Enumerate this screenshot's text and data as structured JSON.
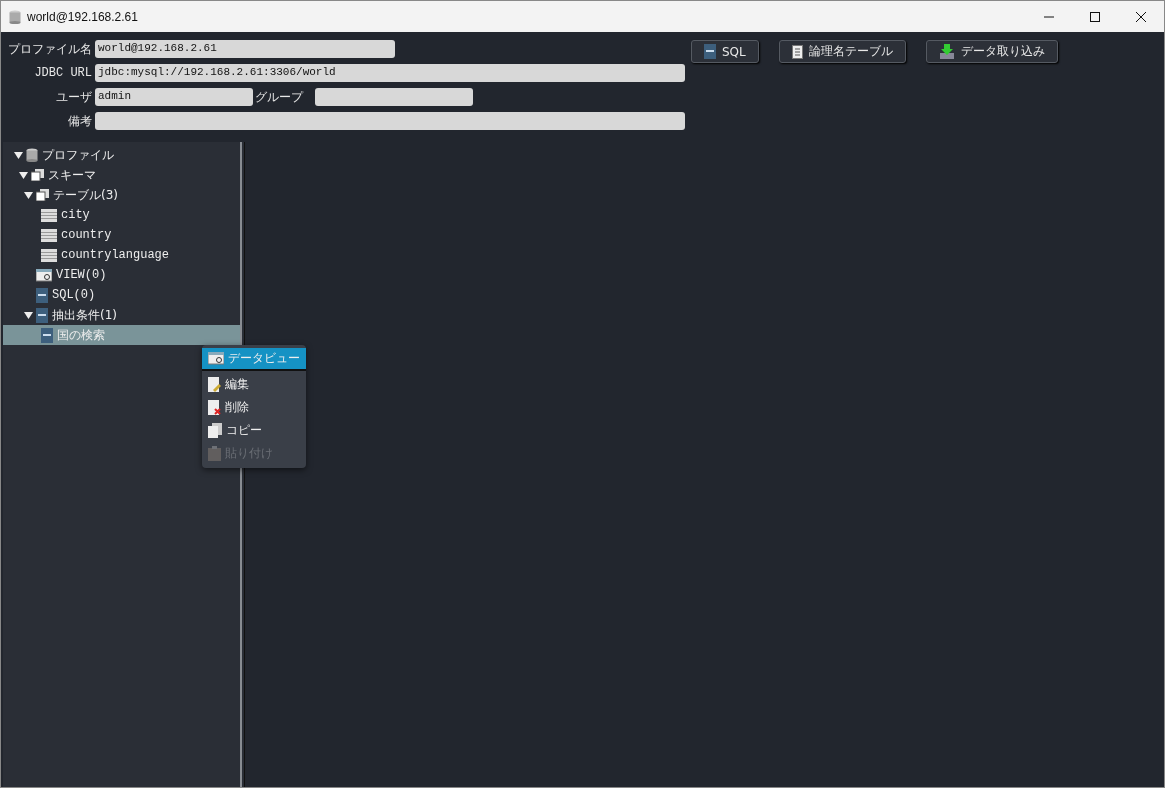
{
  "window": {
    "title": "world@192.168.2.61"
  },
  "form": {
    "rows": [
      [
        {
          "label": "プロファイル名",
          "value": "world@192.168.2.61"
        }
      ],
      [
        {
          "label": "JDBC URL",
          "value": "jdbc:mysql://192.168.2.61:3306/world"
        }
      ],
      [
        {
          "label": "ユーザ",
          "value": "admin"
        },
        {
          "label": "グループ"
        }
      ],
      [
        {
          "label": "備考"
        }
      ]
    ]
  },
  "buttons": [
    {
      "label": "SQL",
      "kind": "sql"
    },
    {
      "label": "論理名テーブル",
      "kind": "logical"
    },
    {
      "label": "データ取り込み",
      "kind": "import"
    }
  ],
  "tree": [
    {
      "label": "プロファイル",
      "kind": "database",
      "expanded": true,
      "selected": false,
      "children": [
        {
          "label": "スキーマ",
          "kind": "schema",
          "expanded": true,
          "selected": false,
          "children": [
            {
              "label": "テーブル(3)",
              "kind": "schema",
              "expanded": true,
              "selected": false,
              "children": [
                {
                  "label": "city",
                  "kind": "table",
                  "selected": false
                },
                {
                  "label": "country",
                  "kind": "table",
                  "selected": false
                },
                {
                  "label": "countrylanguage",
                  "kind": "table",
                  "selected": false
                }
              ]
            },
            {
              "label": "VIEW(0)",
              "kind": "view",
              "selected": false
            },
            {
              "label": "SQL(0)",
              "kind": "sql",
              "selected": false
            },
            {
              "label": "抽出条件(1)",
              "kind": "sql",
              "expanded": true,
              "selected": false,
              "children": [
                {
                  "label": "国の検索",
                  "kind": "sql",
                  "selected": true
                }
              ]
            }
          ]
        }
      ]
    }
  ],
  "context_menu": [
    {
      "label": "データビュー",
      "kind": "view",
      "selected": true,
      "disabled": false
    },
    {
      "label": "編集",
      "kind": "edit",
      "selected": false,
      "disabled": false
    },
    {
      "label": "削除",
      "kind": "delete",
      "selected": false,
      "disabled": false
    },
    {
      "label": "コピー",
      "kind": "copy",
      "selected": false,
      "disabled": false
    },
    {
      "label": "貼り付け",
      "kind": "paste",
      "selected": false,
      "disabled": true
    }
  ]
}
